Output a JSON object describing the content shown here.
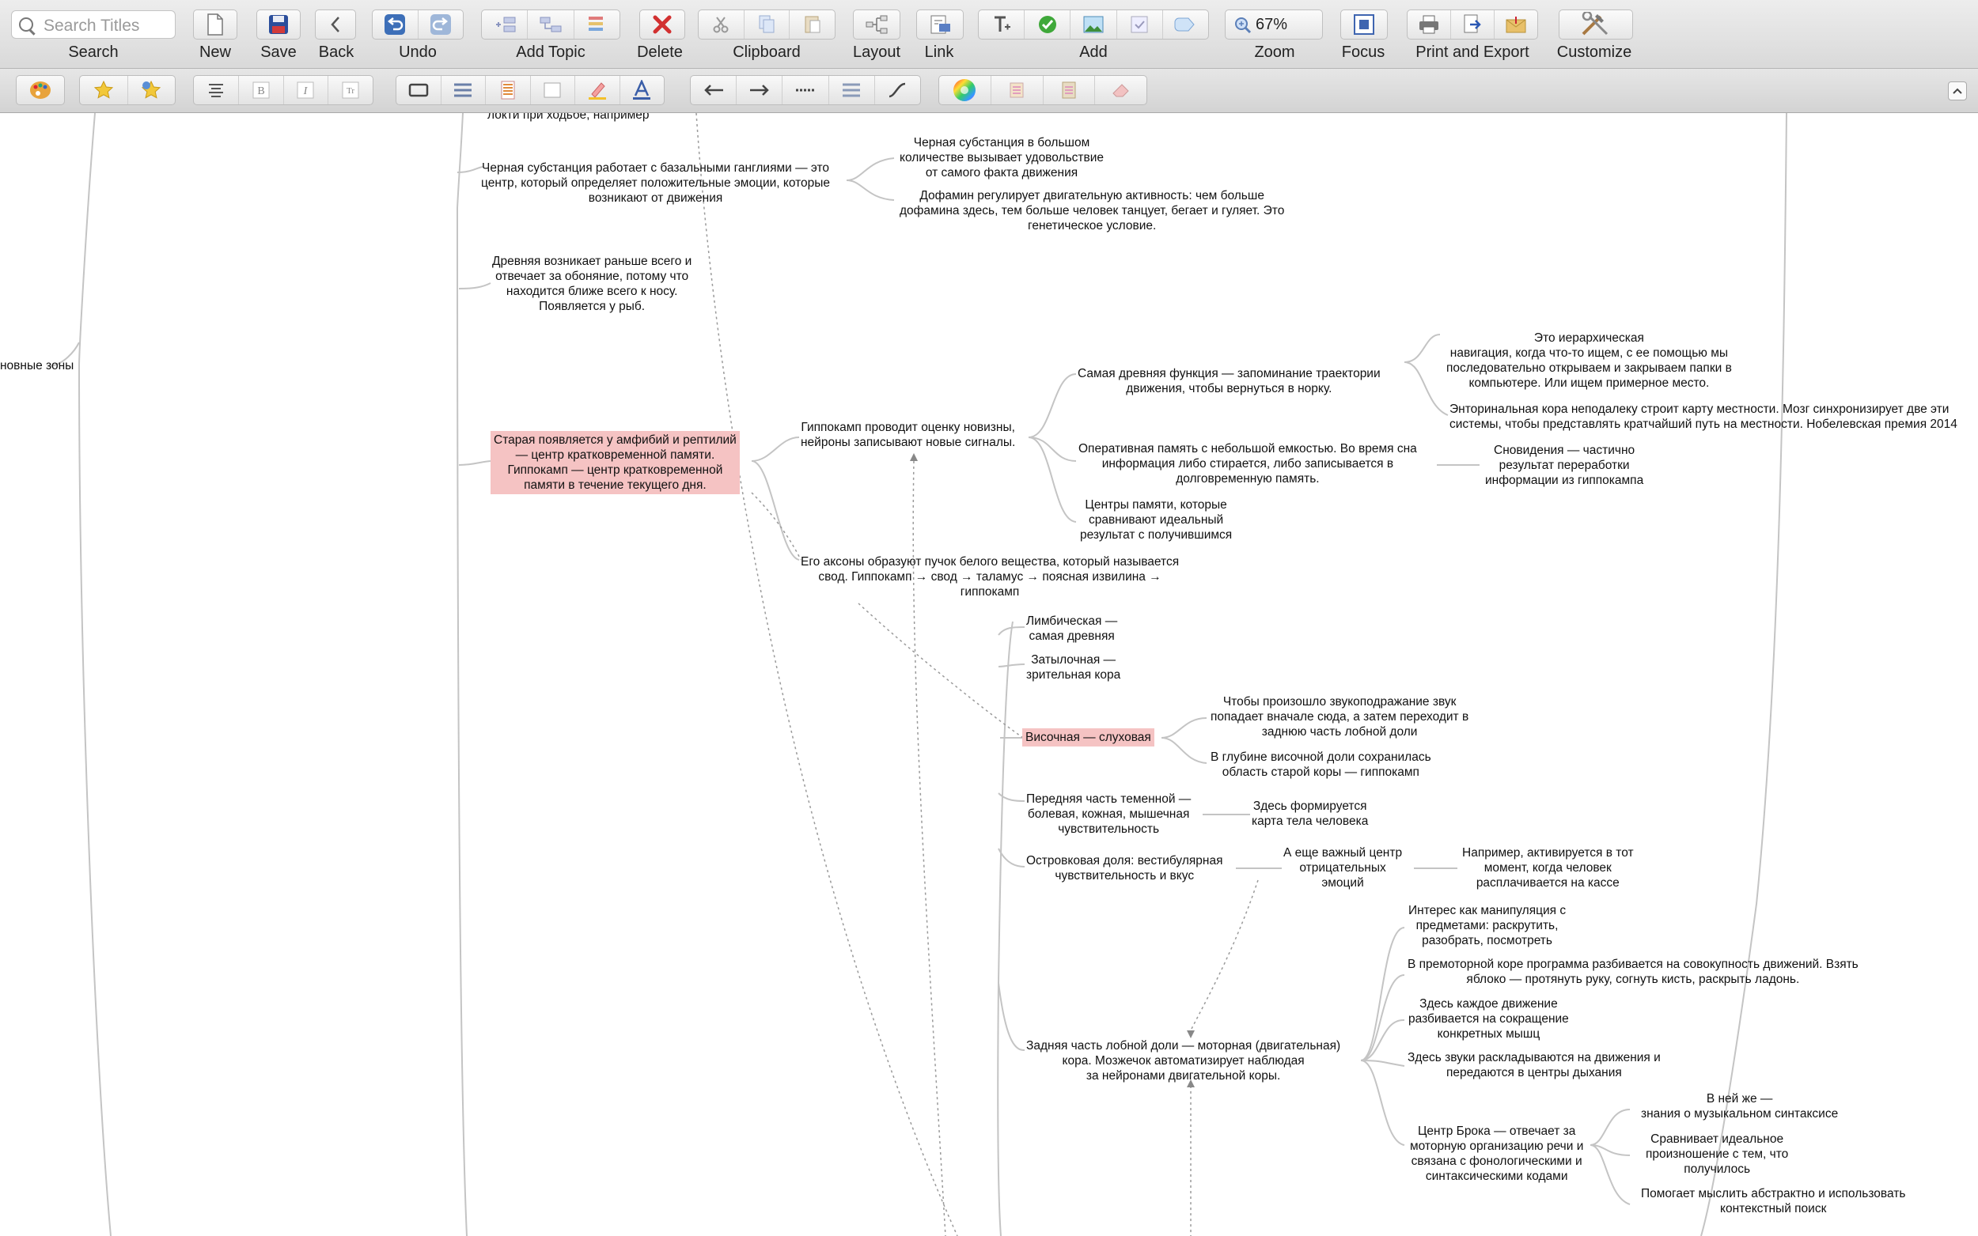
{
  "toolbar": {
    "search_placeholder": "Search Titles",
    "labels": {
      "search": "Search",
      "new": "New",
      "save": "Save",
      "back": "Back",
      "undo": "Undo",
      "add_topic": "Add Topic",
      "delete": "Delete",
      "clipboard": "Clipboard",
      "layout": "Layout",
      "link": "Link",
      "add": "Add",
      "zoom": "Zoom",
      "focus": "Focus",
      "print_export": "Print and Export",
      "customize": "Customize"
    },
    "zoom_value": "67%"
  },
  "map": {
    "n_top_cut": "локти при ходьбе, например",
    "n_black_subst": "Черная субстанция работает с базальными ганглиями — это\nцентр, который определяет положительные эмоции, которые\nвозникают от движения",
    "n_black_big": "Черная субстанция в большом\nколичестве вызывает удовольствие\nот самого факта движения",
    "n_dopamine": "Дофамин регулирует двигательную активность: чем больше\nдофамина здесь, тем больше человек танцует, бегает и гуляет. Это\nгенетическое условие.",
    "n_zones": "новные зоны",
    "n_ancient": "Древняя возникает раньше всего и\nотвечает за обоняние, потому что\nнаходится ближе всего к носу.\nПоявляется у рыб.",
    "n_old": "Старая появляется у амфибий и рептилий\n— центр кратковременной памяти.\nГиппокамп — центр кратковременной\nпамяти в течение текущего дня.",
    "n_hippo_novelty": "Гиппокамп проводит оценку новизны,\nнейроны записывают новые сигналы.",
    "n_oldest_fn": "Самая древняя функция — запоминание траектории\nдвижения, чтобы вернуться в норку.",
    "n_hier_nav": "Это иерархическая\nнавигация, когда что-то ищем, с ее помощью мы\nпоследовательно открываем и закрываем папки в\nкомпьютере. Или ищем примерное место.",
    "n_entorhinal": "Энторинальная кора неподалеку строит карту местности. Мозг синхронизирует две эти\nсистемы, чтобы представлять кратчайший путь на местности. Нобелевская премия 2014",
    "n_working_mem": "Оперативная память с небольшой емкостью. Во время сна\nинформация либо стирается, либо записывается в\nдолговременную память.",
    "n_dreams": "Сновидения — частично\nрезультат переработки\nинформации из гиппокампа",
    "n_mem_centers": "Центры памяти, которые\nсравнивают идеальный\nрезультат с получившимся",
    "n_axons": "Его аксоны образуют пучок белого вещества, который называется\nсвод. Гиппокамп → свод → таламус → поясная извилина →\nгиппокамп",
    "n_limbic": "Лимбическая —\nсамая древняя",
    "n_occipital": "Затылочная —\nзрительная кора",
    "n_temporal": "Височная — слуховая",
    "n_sound_imit": "Чтобы произошло звукоподражание звук\nпопадает вначале сюда, а затем переходит в\nзаднюю часть лобной доли",
    "n_deep_temporal": "В глубине височной доли сохранилась\nобласть старой коры — гиппокамп",
    "n_parietal": "Передняя часть теменной —\nболевая, кожная, мышечная\nчувствительность",
    "n_body_map": "Здесь формируется\nкарта тела человека",
    "n_insular": "Островковая доля: вестибулярная\nчувствительность и вкус",
    "n_neg_center": "А еще важный центр\nотрицательных\nэмоций",
    "n_checkout": "Например, активируется в тот\nмомент, когда человек\nрасплачивается на кассе",
    "n_interest": "Интерес как манипуляция с\nпредметами: раскрутить,\nразобрать, посмотреть",
    "n_premotor": "В премоторной коре программа разбивается на совокупность движений. Взять\nяблоко — протянуть руку, согнуть кисть, раскрыть ладонь.",
    "n_each_move": "Здесь каждое движение\nразбивается на сокращение\nконкретных мышц",
    "n_sounds_split": "Здесь звуки раскладываются на движения и\nпередаются в центры дыхания",
    "n_motor": "Задняя часть лобной доли — моторная (двигательная)\nкора. Мозжечок автоматизирует наблюдая\nза нейронами двигательной коры.",
    "n_broca": "Центр Брока — отвечает за\nмоторную организацию речи и\nсвязана с фонологическими и\nсинтаксическими кодами",
    "n_music": "В ней же —\nзнания о музыкальном синтаксисе",
    "n_compare": "Сравнивает идеальное\nпроизношение с тем, что\nполучилось",
    "n_abstract": "Помогает мыслить абстрактно и использовать\nконтекстный поиск"
  },
  "colors": {
    "highlight": "#f5c3c3",
    "line": "#bdbdbd"
  }
}
